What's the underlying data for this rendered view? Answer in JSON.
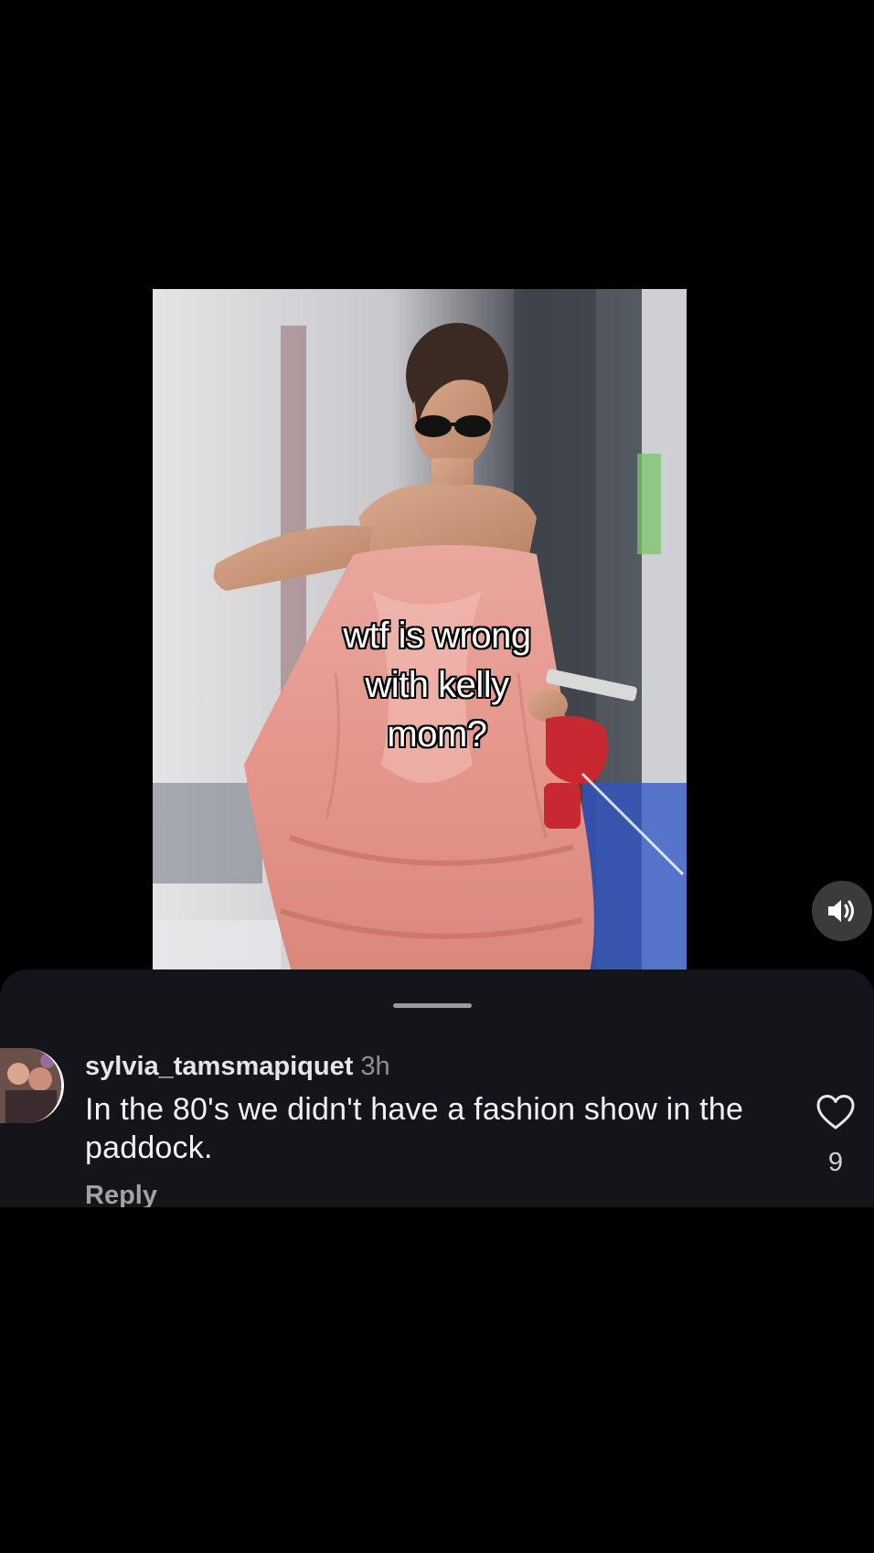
{
  "video": {
    "overlay_caption_lines": [
      "wtf is wrong",
      "with kelly",
      "mom?"
    ]
  },
  "controls": {
    "volume_icon": "speaker-on-icon"
  },
  "comments": [
    {
      "username": "sylvia_tamsmapiquet",
      "timestamp": "3h",
      "text": "In the 80's we didn't have a fashion show in the paddock.",
      "reply_label": "Reply",
      "like_icon": "heart-outline-icon",
      "like_count": "9"
    }
  ],
  "colors": {
    "background": "#000000",
    "sheet": "#14141a",
    "username": "#e6e6ea",
    "timestamp": "#8e8e93",
    "comment_text": "#f2f2f5"
  }
}
